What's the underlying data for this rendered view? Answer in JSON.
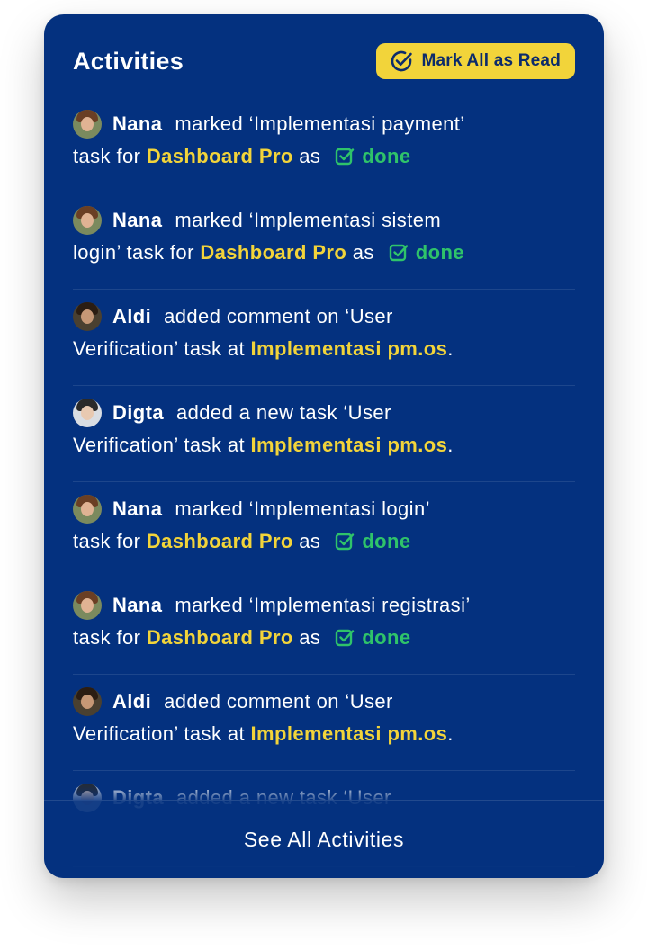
{
  "header": {
    "title": "Activities",
    "mark_all_label": "Mark All as Read"
  },
  "activities": [
    {
      "user": "Nana",
      "line1": "marked ‘Implementasi payment’",
      "line2_prefix": "task for",
      "project": "Dashboard Pro",
      "suffix": "as",
      "status": "done"
    },
    {
      "user": "Nana",
      "line1": "marked ‘Implementasi sistem",
      "line2_prefix": "login’ task for",
      "project": "Dashboard Pro",
      "suffix": "as",
      "status": "done"
    },
    {
      "user": "Aldi",
      "line1": "added comment on ‘User",
      "line2_prefix": "Verification’ task at",
      "project": "Implementasi pm.os",
      "suffix": "."
    },
    {
      "user": "Digta",
      "line1": "added a new task ‘User",
      "line2_prefix": "Verification’ task at",
      "project": "Implementasi pm.os",
      "suffix": "."
    },
    {
      "user": "Nana",
      "line1": "marked ‘Implementasi login’",
      "line2_prefix": "task for",
      "project": "Dashboard Pro",
      "suffix": "as",
      "status": "done"
    },
    {
      "user": "Nana",
      "line1": "marked ‘Implementasi registrasi’",
      "line2_prefix": "task for",
      "project": "Dashboard Pro",
      "suffix": "as",
      "status": "done"
    },
    {
      "user": "Aldi",
      "line1": "added comment on ‘User",
      "line2_prefix": "Verification’ task at",
      "project": "Implementasi pm.os",
      "suffix": "."
    },
    {
      "user": "Digta",
      "line1": "added a new task ‘User"
    }
  ],
  "footer": {
    "see_all_label": "See All Activities"
  },
  "colors": {
    "card_bg": "#04317f",
    "accent_yellow": "#f2d43a",
    "done_green": "#2fc36a"
  },
  "icons": {
    "mark_all": "check-circle-icon",
    "done": "check-square-icon"
  }
}
